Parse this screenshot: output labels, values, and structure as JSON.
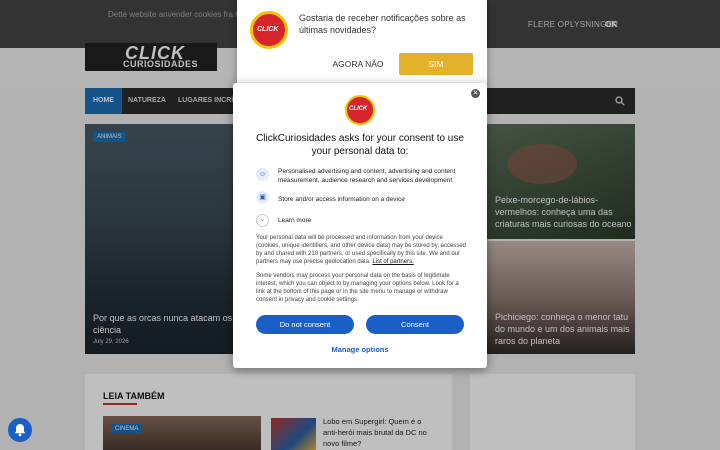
{
  "cookie_bar": {
    "text": "Dette website anvender cookies fra G... brugeragent deles med Google samm... tjenestekvaliteten, generere brugssta...",
    "more_label": "FLERE OPLYSNINGER",
    "ok_label": "OK"
  },
  "logo": {
    "line1": "CLICK",
    "line2": "CURIOSIDADES"
  },
  "nav": {
    "items": [
      "HOME",
      "NATUREZA",
      "LUGARES INCRÍV",
      "S"
    ]
  },
  "featured": {
    "main": {
      "tag": "ANIMAIS",
      "title": "Por que as orcas nunca atacam os humanos? Entenda a explicação da ciência",
      "date": "July 29, 2026"
    },
    "top_right": {
      "title": "Peixe-morcego-de-lábios-vermelhos: conheça uma das criaturas mais curiosas do oceano"
    },
    "bottom_right": {
      "title": "Pichiciego: conheça o menor tatu do mundo e um dos animais mais raros do planeta"
    }
  },
  "leia": {
    "title": "LEIA TAMBÉM",
    "card_tag": "CINEMA",
    "headline": "Lobo em Supergirl: Quem é o anti-herói mais brutal da DC no novo filme?"
  },
  "notification": {
    "text": "Gostaria de receber notificações sobre as últimas novidades?",
    "no_label": "AGORA NÃO",
    "yes_label": "SIM",
    "logo_text": "CLICK"
  },
  "consent": {
    "title": "ClickCuriosidades asks for your consent to use your personal data to:",
    "purpose1": "Personalised advertising and content, advertising and content measurement, audience research and services development",
    "purpose2": "Store and/or access information on a device",
    "learn_more": "Learn more",
    "body1": "Your personal data will be processed and information from your device (cookies, unique identifiers, and other device data) may be stored by, accessed by and shared with 210 partners, or used specifically by this site. We and our partners may use precise geolocation data.",
    "partners_link": "List of partners.",
    "body2": "Some vendors may process your personal data on the basis of legitimate interest, which you can object to by managing your options below. Look for a link at the bottom of this page or in the site menu to manage or withdraw consent in privacy and cookie settings.",
    "do_not_consent": "Do not consent",
    "consent_label": "Consent",
    "manage_options": "Manage options",
    "logo_text": "CLICK"
  },
  "colors": {
    "accent": "#1a6fb5",
    "consent_blue": "#1a5ec8",
    "notif_yes": "#e4b22a",
    "brand_red": "#d6262b"
  }
}
